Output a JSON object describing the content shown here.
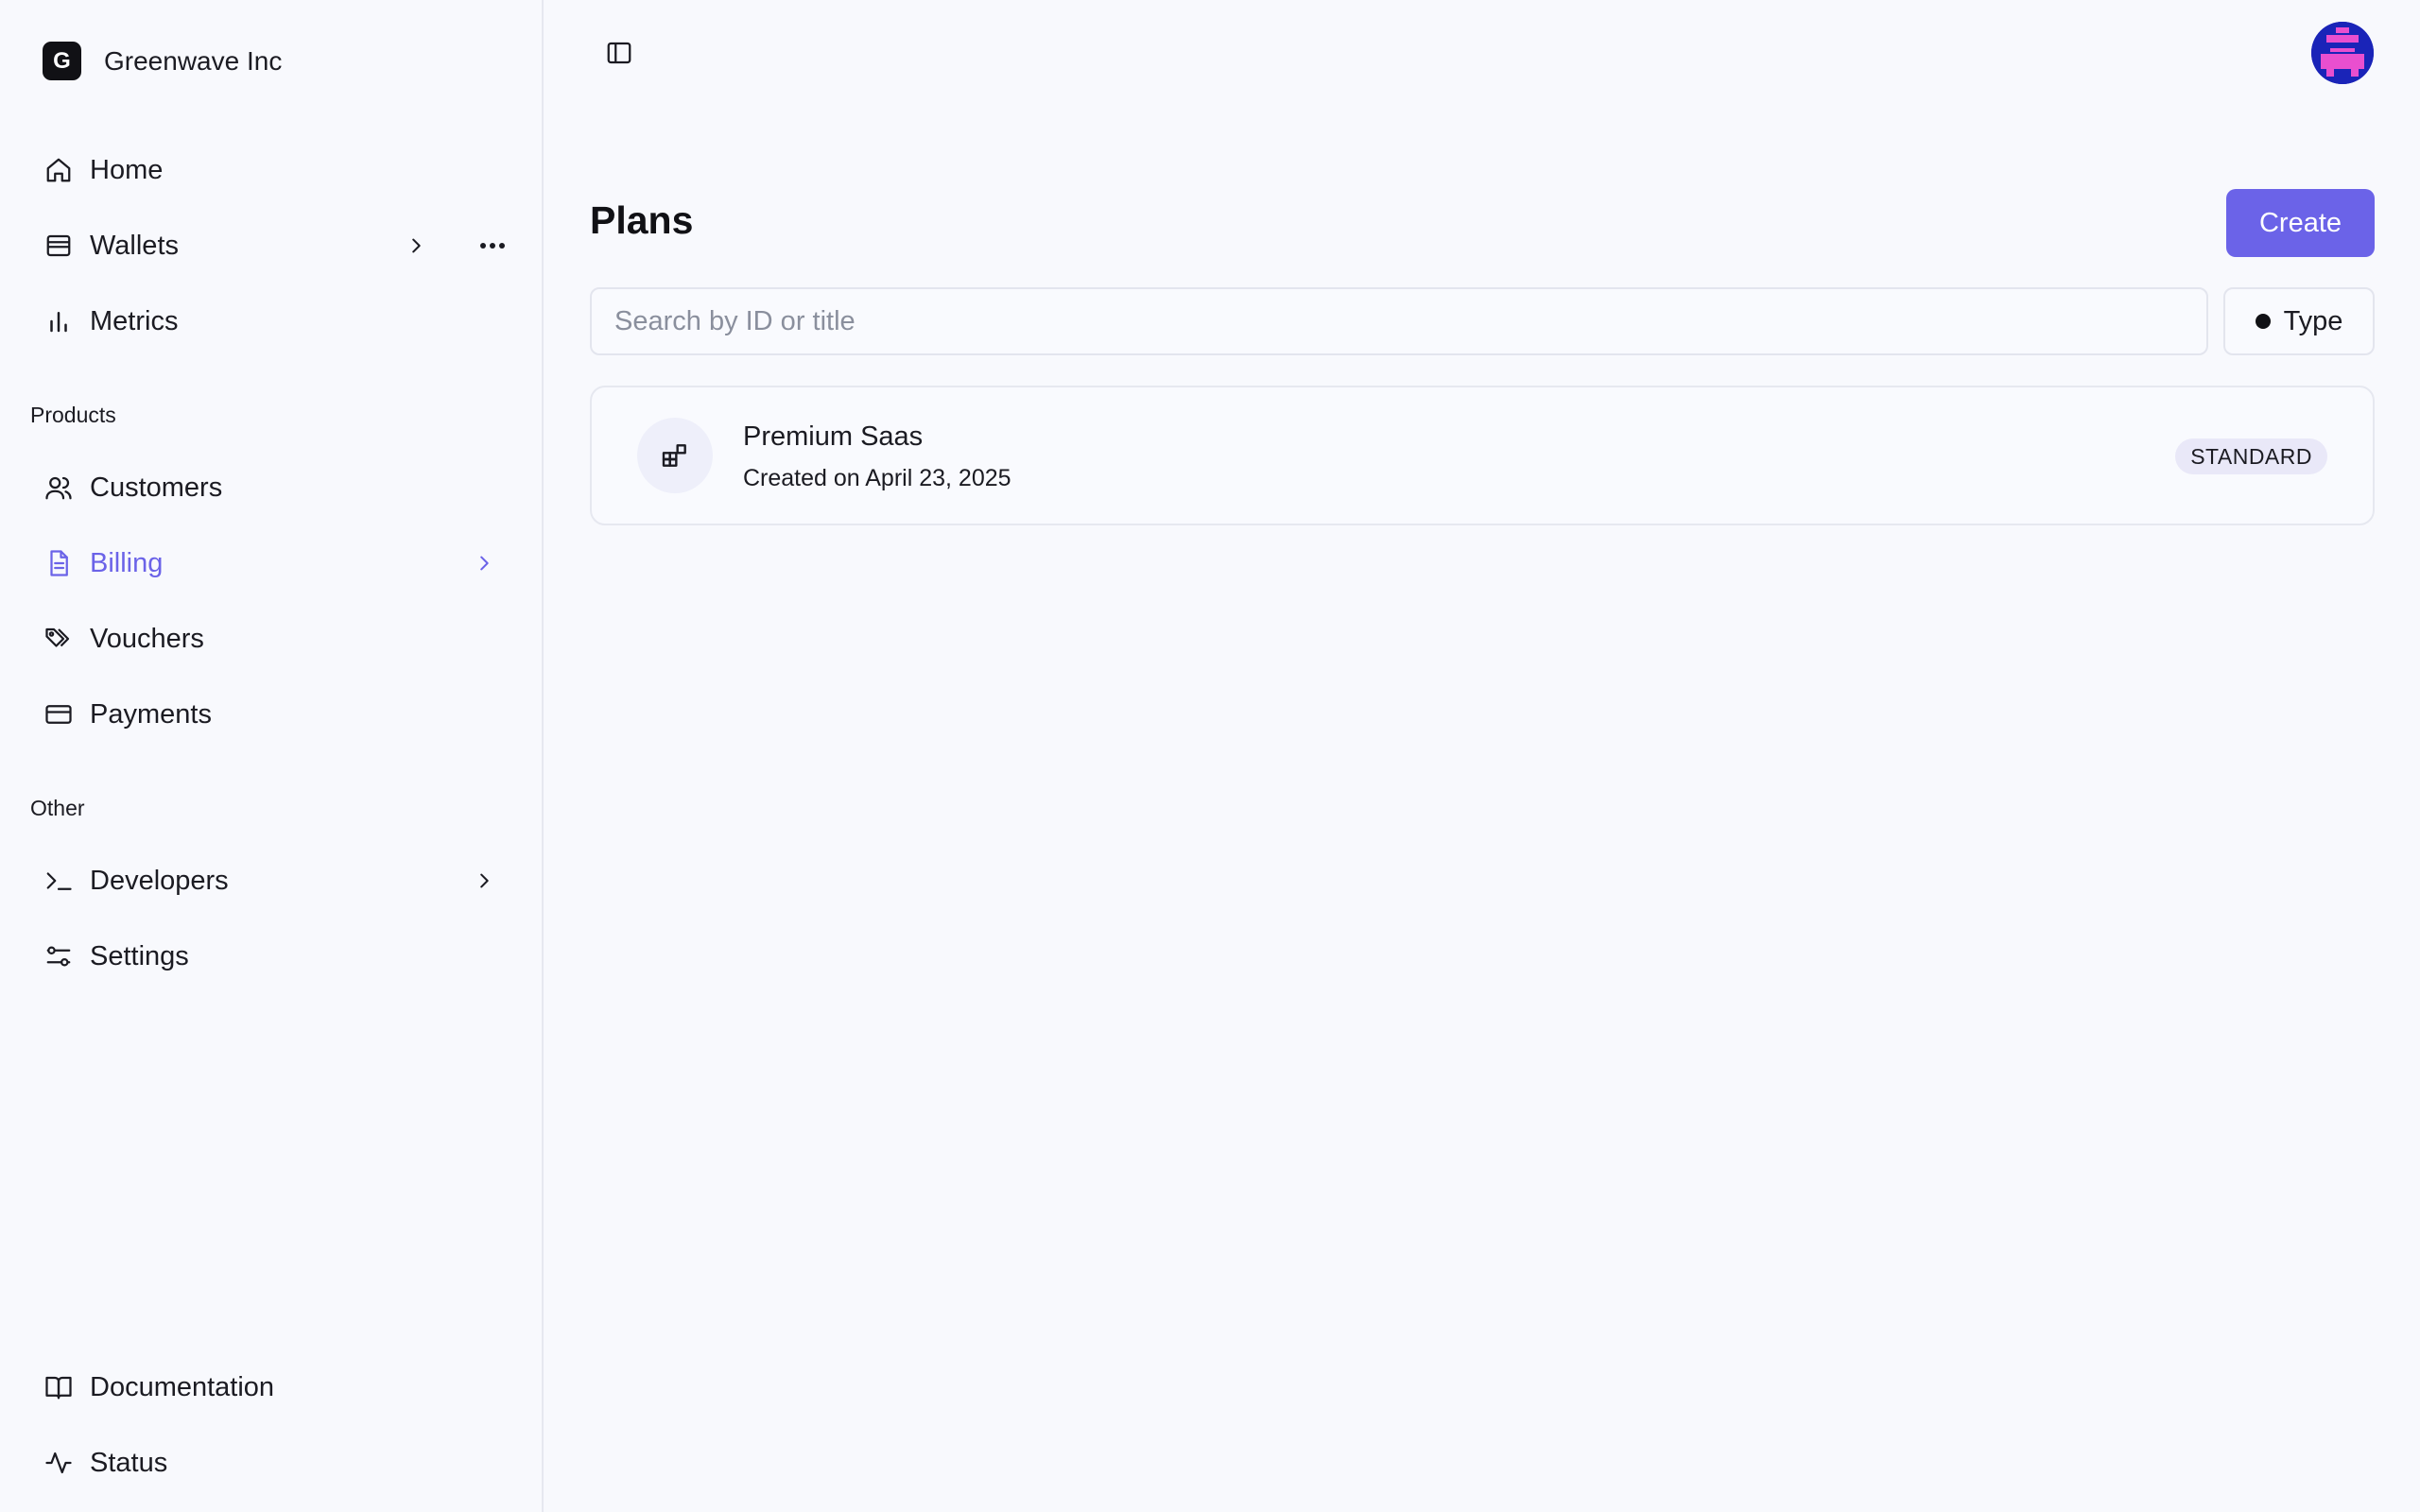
{
  "sidebar": {
    "brand": {
      "logo_letter": "G",
      "name": "Greenwave Inc"
    },
    "main_items": [
      {
        "label": "Home",
        "icon": "home-icon"
      },
      {
        "label": "Wallets",
        "icon": "wallet-icon"
      },
      {
        "label": "Metrics",
        "icon": "bar-chart-icon"
      }
    ],
    "products_label": "Products",
    "product_items": [
      {
        "label": "Customers",
        "icon": "users-icon"
      },
      {
        "label": "Billing",
        "icon": "document-icon",
        "active": true
      },
      {
        "label": "Vouchers",
        "icon": "tags-icon"
      },
      {
        "label": "Payments",
        "icon": "credit-card-icon"
      }
    ],
    "other_label": "Other",
    "other_items": [
      {
        "label": "Developers",
        "icon": "terminal-icon"
      },
      {
        "label": "Settings",
        "icon": "sliders-icon"
      }
    ],
    "footer_items": [
      {
        "label": "Documentation",
        "icon": "book-icon"
      },
      {
        "label": "Status",
        "icon": "activity-icon"
      }
    ]
  },
  "main": {
    "title": "Plans",
    "create_label": "Create",
    "search_placeholder": "Search by ID or title",
    "filter_label": "Type",
    "plans": [
      {
        "title": "Premium Saas",
        "subtitle": "Created on April 23, 2025",
        "badge": "STANDARD",
        "icon": "blocks-icon"
      }
    ]
  },
  "colors": {
    "accent": "#6b63e8",
    "background": "#f8f9fd",
    "border": "#e6e8f0",
    "avatar_bg": "#1a24b8",
    "avatar_fg": "#e94fcf"
  }
}
